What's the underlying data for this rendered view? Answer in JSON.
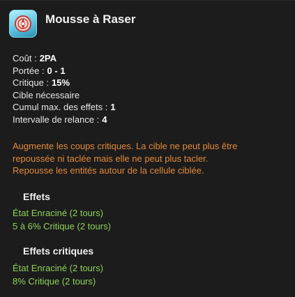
{
  "spell": {
    "title": "Mousse à Raser",
    "icon": "shaving-foam-spell-icon"
  },
  "stats": [
    {
      "label": "Coût :",
      "value": "2PA"
    },
    {
      "label": "Portée :",
      "value": "0 - 1"
    },
    {
      "label": "Critique :",
      "value": "15%"
    },
    {
      "label": "Cible nécessaire",
      "value": ""
    },
    {
      "label": "Cumul max. des effets :",
      "value": "1"
    },
    {
      "label": "Intervalle de relance :",
      "value": "4"
    }
  ],
  "description": [
    "Augmente les coups critiques. La cible ne peut plus être",
    "repoussée ni taclée mais elle ne peut plus tacler.",
    "Repousse les entités autour de la cellule ciblée."
  ],
  "effects": {
    "title": "Effets",
    "items": [
      "État Enraciné (2 tours)",
      "5 à 6% Critique (2 tours)"
    ]
  },
  "critical_effects": {
    "title": "Effets critiques",
    "items": [
      "État Enraciné (2 tours)",
      "8% Critique (2 tours)"
    ]
  },
  "colors": {
    "background": "#1c1c1c",
    "description": "#e28a3a",
    "effects": "#8fd15a",
    "icon": "#5fc6e3"
  }
}
